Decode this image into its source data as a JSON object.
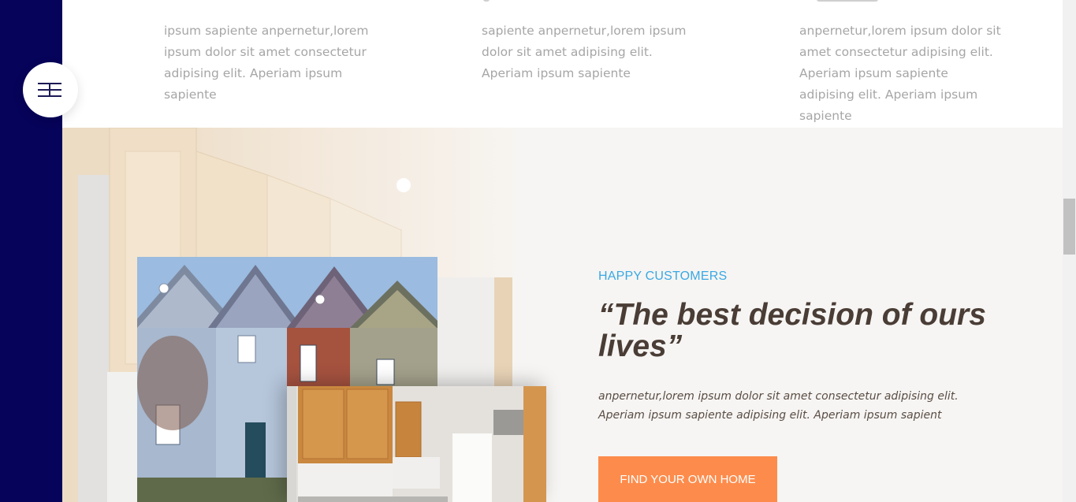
{
  "menu": {
    "icon": "hamburger-menu-icon"
  },
  "features": [
    {
      "text": "ipsum sapiente anpernetur,lorem ipsum dolor sit amet consectetur adipising elit. Aperiam ipsum sapiente"
    },
    {
      "text": "sapiente anpernetur,lorem ipsum dolor sit amet adipising elit. Aperiam ipsum sapiente"
    },
    {
      "text": "anpernetur,lorem ipsum dolor sit amet consectetur adipising elit. Aperiam ipsum sapiente adipising elit. Aperiam ipsum sapiente"
    }
  ],
  "testimonial": {
    "eyebrow": "HAPPY CUSTOMERS",
    "quote": "“The best decision of ours lives”",
    "body": "anpernetur,lorem ipsum dolor sit amet consectetur adipising elit. Aperiam ipsum sapiente adipising elit. Aperiam ipsum sapient",
    "cta_label": "FIND YOUR OWN HOME"
  },
  "colors": {
    "sidebar": "#06035a",
    "accent_blue": "#3aa8e4",
    "accent_orange": "#fd8c4c",
    "heading": "#4a3d36",
    "muted_text": "#a6a6a6",
    "section_bg": "#f6f5f3"
  }
}
